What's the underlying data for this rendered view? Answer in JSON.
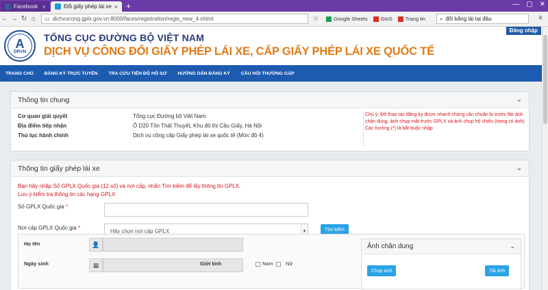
{
  "browser": {
    "tabs": [
      {
        "label": "Facebook",
        "color": "#3b5998"
      },
      {
        "label": "Đổi giấy phép lái xe",
        "color": "#1d9bd7"
      }
    ],
    "new_tab": "+",
    "url": "dichvucong.gplx.gov.vn:8000/faces/registration/regis_new_4.xhtml",
    "bookmarks": [
      {
        "label": "Google Sheets",
        "color": "#1e9e55"
      },
      {
        "label": "GtoS",
        "color": "#d93025"
      },
      {
        "label": "Trang tin",
        "color": "#d93025"
      }
    ],
    "search_value": "đổi bằng lái tại đâu"
  },
  "header": {
    "logo_text": "A",
    "logo_sub": "DRVN",
    "org_name": "TỔNG CỤC ĐƯỜNG BỘ VIỆT NAM",
    "service_name": "DỊCH VỤ CÔNG ĐỔI GIẤY PHÉP LÁI XE, CẤP GIẤY PHÉP LÁI XE QUỐC TẾ",
    "login_label": "Đăng nhập"
  },
  "nav": {
    "items": [
      "TRANG CHỦ",
      "ĐĂNG KÝ TRỰC TUYẾN",
      "TRA CỨU TIẾN ĐỘ HỒ SƠ",
      "HƯỚNG DẪN ĐĂNG KÝ",
      "CÂU HỎI THƯỜNG GẶP"
    ]
  },
  "general": {
    "title": "Thông tin chung",
    "rows": [
      {
        "label": "Cơ quan giải quyết",
        "value": "Tổng cục Đường bộ Việt Nam"
      },
      {
        "label": "Địa điểm tiếp nhận",
        "value": "Ô D20 Tôn Thất Thuyết, Khu đô thị Cầu Giấy, Hà Nội"
      },
      {
        "label": "Thủ tục hành chính",
        "value": "Dịch vụ công cấp Giấy phép lái xe quốc tế (Mức độ 4)"
      }
    ],
    "note": "Chú ý: Để thao tác đăng ký được nhanh chóng cần chuẩn bị trước file ảnh chân dung, ảnh chụp mặt trước GPLX và ảnh chụp hộ chiếu (trang có ảnh)",
    "note_required": "Các trường (*) là bắt buộc nhập"
  },
  "license": {
    "title": "Thông tin giấy phép lái xe",
    "instruction1": "Bạn hãy nhập Số GPLX Quốc gia (12 số) và nơi cấp, nhấn Tìm kiếm để lấy thông tin GPLX.",
    "instruction2": "Lưu ý kiểm tra thông tin các hạng GPLX",
    "number_label": "Số GPLX Quốc gia",
    "issuer_label": "Nơi cấp GPLX Quốc gia",
    "required_mark": "*",
    "issuer_placeholder": "Hãy chọn nơi cấp GPLX",
    "search_button": "Tìm kiếm",
    "name_label": "Họ tên",
    "dob_label": "Ngày sinh",
    "gender_label": "Giới tính",
    "gender_male": "Nam",
    "gender_female": "Nữ"
  },
  "portrait": {
    "title": "Ảnh chân dung",
    "capture_button": "Chụp ảnh",
    "upload_button": "Tải ảnh"
  }
}
